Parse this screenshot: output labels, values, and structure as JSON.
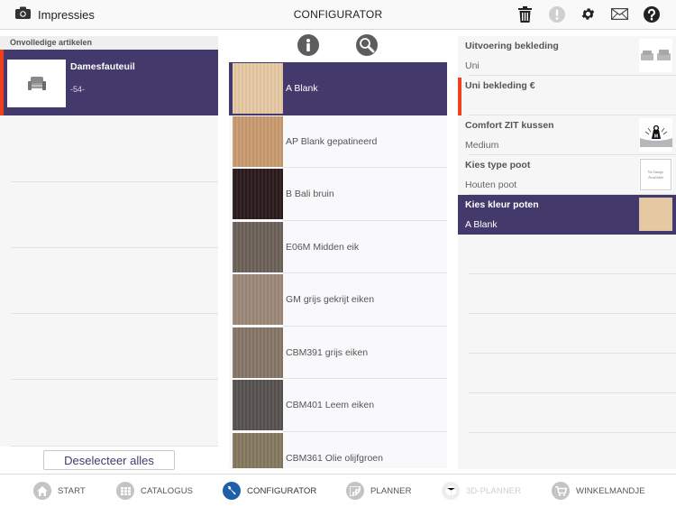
{
  "header": {
    "impressies_label": "Impressies",
    "title": "CONFIGURATOR",
    "icons": [
      "trash-icon",
      "alert-icon",
      "gear-icon",
      "mail-icon",
      "help-icon"
    ]
  },
  "left_panel": {
    "section_header": "Onvolledige artikelen",
    "items": [
      {
        "name": "Damesfauteuil",
        "code": "-54-",
        "selected": true
      }
    ],
    "deselect_label": "Deselecteer alles"
  },
  "middle_panel": {
    "tools": [
      "info-icon",
      "search-icon"
    ],
    "options": [
      {
        "label": "A Blank",
        "swatch": "#e6c9a2",
        "selected": true
      },
      {
        "label": "AP Blank gepatineerd",
        "swatch": "#c89a6e",
        "selected": false
      },
      {
        "label": "B Bali bruin",
        "swatch": "#2a1a1c",
        "selected": false
      },
      {
        "label": "E06M Midden eik",
        "swatch": "#6d6258",
        "selected": false
      },
      {
        "label": "GM grijs gekrijt eiken",
        "swatch": "#9c8878",
        "selected": false
      },
      {
        "label": "CBM391 grijs eiken",
        "swatch": "#857667",
        "selected": false
      },
      {
        "label": "CBM401 Leem eiken",
        "swatch": "#57524f",
        "selected": false
      },
      {
        "label": "CBM361 Olie olijfgroen",
        "swatch": "#85785f",
        "selected": false
      }
    ]
  },
  "right_panel": {
    "properties": [
      {
        "title": "Uitvoering bekleding",
        "value": "Uni",
        "thumb": "sofa-thumbnail",
        "selected": false,
        "incomplete": false
      },
      {
        "title": "Uni bekleding €",
        "value": "",
        "thumb": "",
        "selected": false,
        "incomplete": true
      },
      {
        "title": "Comfort ZIT kussen",
        "value": "Medium",
        "thumb": "weight-cushion-thumbnail",
        "selected": false,
        "incomplete": false
      },
      {
        "title": "Kies type poot",
        "value": "Houten poot",
        "thumb": "no-image-thumbnail",
        "selected": false,
        "incomplete": false
      },
      {
        "title": "Kies kleur poten",
        "value": "A Blank",
        "thumb": "swatch-thumbnail",
        "selected": true,
        "incomplete": false
      }
    ],
    "no_image_text": "No Image Available",
    "weight_label": "M"
  },
  "bottom_nav": {
    "items": [
      {
        "label": "START",
        "icon": "home-icon",
        "state": "normal"
      },
      {
        "label": "CATALOGUS",
        "icon": "grid-icon",
        "state": "normal"
      },
      {
        "label": "CONFIGURATOR",
        "icon": "wrench-icon",
        "state": "active"
      },
      {
        "label": "PLANNER",
        "icon": "planner-icon",
        "state": "normal"
      },
      {
        "label": "3D-PLANNER",
        "icon": "cube-icon",
        "state": "disabled"
      },
      {
        "label": "WINKELMANDJE",
        "icon": "cart-icon",
        "state": "normal"
      }
    ]
  },
  "colors": {
    "accent": "#433a6b",
    "incomplete_marker": "#f0411c",
    "active_nav": "#1f5fa8"
  }
}
